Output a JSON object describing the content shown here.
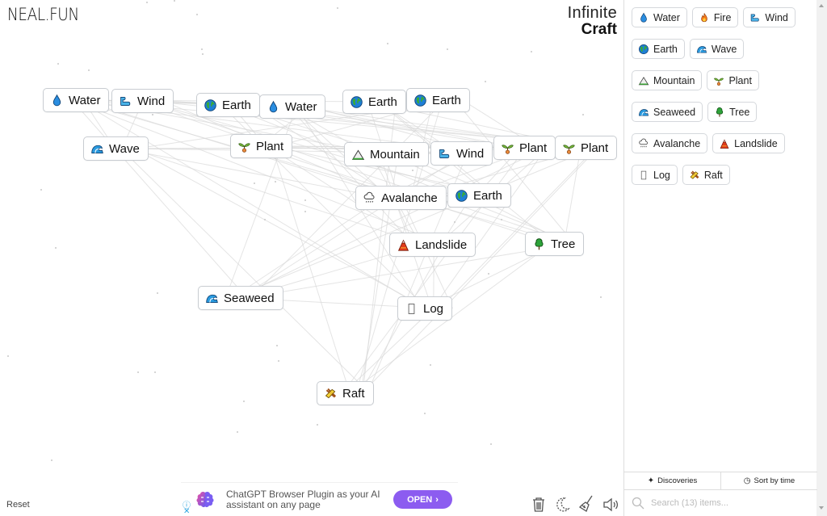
{
  "header": {
    "logo": "NEAL.FUN",
    "brand_line1": "Infinite",
    "brand_line2": "Craft"
  },
  "canvas": {
    "nodes": [
      {
        "label": "Water",
        "icon": "water-drop-icon",
        "emoji": "water"
      },
      {
        "label": "Wind",
        "icon": "wind-icon",
        "emoji": "wind"
      },
      {
        "label": "Earth",
        "icon": "earth-globe-icon",
        "emoji": "earth"
      },
      {
        "label": "Water",
        "icon": "water-drop-icon",
        "emoji": "water"
      },
      {
        "label": "Earth",
        "icon": "earth-globe-icon",
        "emoji": "earth"
      },
      {
        "label": "Earth",
        "icon": "earth-globe-icon",
        "emoji": "earth"
      },
      {
        "label": "Wave",
        "icon": "wave-icon",
        "emoji": "wave"
      },
      {
        "label": "Plant",
        "icon": "seedling-icon",
        "emoji": "plant"
      },
      {
        "label": "Mountain",
        "icon": "mountain-icon",
        "emoji": "mountain"
      },
      {
        "label": "Wind",
        "icon": "wind-icon",
        "emoji": "wind"
      },
      {
        "label": "Plant",
        "icon": "seedling-icon",
        "emoji": "plant"
      },
      {
        "label": "Plant",
        "icon": "seedling-icon",
        "emoji": "plant"
      },
      {
        "label": "Avalanche",
        "icon": "snow-cloud-icon",
        "emoji": "avalanche"
      },
      {
        "label": "Earth",
        "icon": "earth-globe-icon",
        "emoji": "earth"
      },
      {
        "label": "Landslide",
        "icon": "volcano-icon",
        "emoji": "landslide"
      },
      {
        "label": "Tree",
        "icon": "tree-icon",
        "emoji": "tree"
      },
      {
        "label": "Seaweed",
        "icon": "wave-icon",
        "emoji": "wave"
      },
      {
        "label": "Log",
        "icon": "missing-glyph-icon",
        "emoji": "log"
      },
      {
        "label": "Raft",
        "icon": "raft-icon",
        "emoji": "raft"
      }
    ],
    "reset_label": "Reset"
  },
  "ad": {
    "text": "ChatGPT Browser Plugin as your AI assistant on any page",
    "button_label": "OPEN",
    "info_glyph": "ⓘ",
    "close_glyph": "✕"
  },
  "toolbar": {
    "icons": [
      "trash-icon",
      "dark-mode-moon-icon",
      "broom-clear-icon",
      "sound-icon"
    ]
  },
  "sidebar": {
    "items": [
      {
        "label": "Water",
        "emoji": "water"
      },
      {
        "label": "Fire",
        "emoji": "fire"
      },
      {
        "label": "Wind",
        "emoji": "wind"
      },
      {
        "label": "Earth",
        "emoji": "earth"
      },
      {
        "label": "Wave",
        "emoji": "wave"
      },
      {
        "label": "Mountain",
        "emoji": "mountain"
      },
      {
        "label": "Plant",
        "emoji": "plant"
      },
      {
        "label": "Seaweed",
        "emoji": "wave"
      },
      {
        "label": "Tree",
        "emoji": "tree"
      },
      {
        "label": "Avalanche",
        "emoji": "avalanche"
      },
      {
        "label": "Landslide",
        "emoji": "landslide"
      },
      {
        "label": "Log",
        "emoji": "log"
      },
      {
        "label": "Raft",
        "emoji": "raft"
      }
    ],
    "discoveries_label": "Discoveries",
    "sort_label": "Sort by time",
    "search_placeholder": "Search (13) items..."
  },
  "colors": {
    "ad_button": "#8c5cf0",
    "node_border": "#c8ccd1"
  }
}
